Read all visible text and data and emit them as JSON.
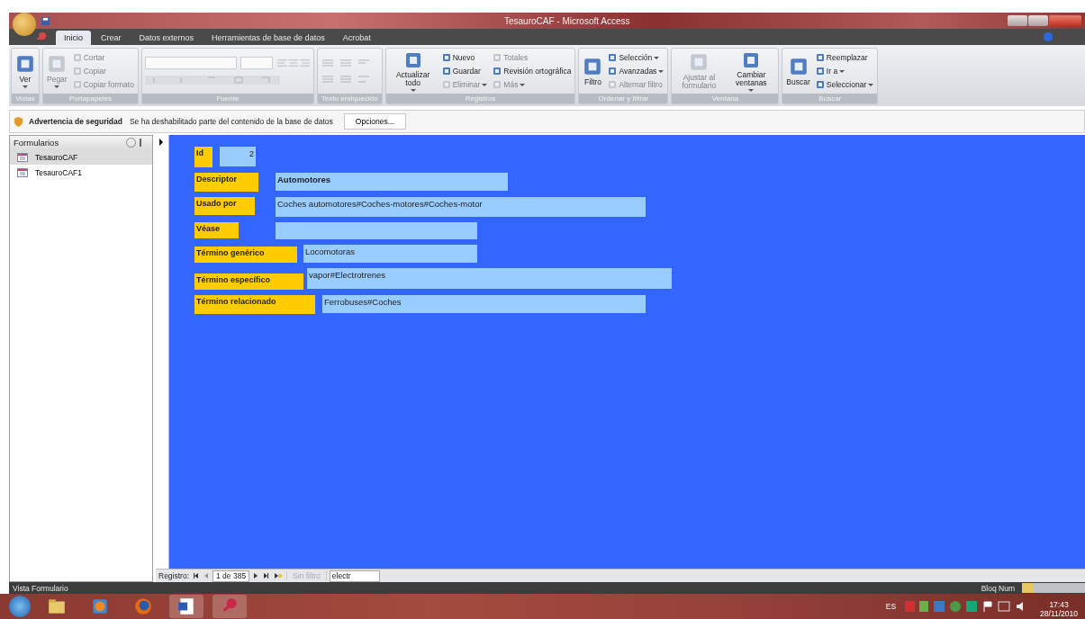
{
  "window": {
    "title": "TesauroCAF - Microsoft Access"
  },
  "tabs": [
    {
      "label": "Inicio",
      "selected": true
    },
    {
      "label": "Crear",
      "selected": false
    },
    {
      "label": "Datos externos",
      "selected": false
    },
    {
      "label": "Herramientas de base de datos",
      "selected": false
    },
    {
      "label": "Acrobat",
      "selected": false
    }
  ],
  "ribbon": [
    {
      "label": "Vistas",
      "kind": "commands",
      "items": [
        {
          "label": "Ver",
          "kind": "large",
          "disabled": false,
          "dropdown": true
        }
      ]
    },
    {
      "label": "Portapapeles",
      "kind": "commands",
      "items": [
        {
          "label": "Pegar",
          "kind": "large",
          "disabled": true,
          "dropdown": true
        },
        {
          "label": "Cortar",
          "kind": "small",
          "disabled": true,
          "dropdown": false
        },
        {
          "label": "Copiar",
          "kind": "small",
          "disabled": true,
          "dropdown": false
        },
        {
          "label": "Copiar formato",
          "kind": "small",
          "disabled": true,
          "dropdown": false
        }
      ]
    },
    {
      "label": "Fuente",
      "kind": "font"
    },
    {
      "label": "Texto enriquecido",
      "kind": "paragraph"
    },
    {
      "label": "Registros",
      "kind": "commands",
      "items": [
        {
          "label": "Actualizar todo",
          "kind": "large",
          "disabled": false,
          "dropdown": true
        },
        {
          "label": "Nuevo",
          "kind": "small",
          "disabled": false,
          "dropdown": false
        },
        {
          "label": "Guardar",
          "kind": "small",
          "disabled": false,
          "dropdown": false
        },
        {
          "label": "Eliminar",
          "kind": "small",
          "disabled": true,
          "dropdown": true
        },
        {
          "label": "Totales",
          "kind": "small",
          "disabled": true,
          "dropdown": false
        },
        {
          "label": "Revisión ortográfica",
          "kind": "small",
          "disabled": false,
          "dropdown": false
        },
        {
          "label": "Más",
          "kind": "small",
          "disabled": true,
          "dropdown": true
        }
      ]
    },
    {
      "label": "Ordenar y filtrar",
      "kind": "commands",
      "items": [
        {
          "label": "Filtro",
          "kind": "large",
          "disabled": false,
          "dropdown": false
        },
        {
          "label": "Selección",
          "kind": "small",
          "disabled": false,
          "dropdown": true
        },
        {
          "label": "Avanzadas",
          "kind": "small",
          "disabled": false,
          "dropdown": true
        },
        {
          "label": "Alternar filtro",
          "kind": "small",
          "disabled": true,
          "dropdown": false
        }
      ]
    },
    {
      "label": "Ventana",
      "kind": "commands",
      "items": [
        {
          "label": "Ajustar al formulario",
          "kind": "large",
          "disabled": true,
          "dropdown": false
        },
        {
          "label": "Cambiar ventanas",
          "kind": "large",
          "disabled": false,
          "dropdown": true
        }
      ]
    },
    {
      "label": "Buscar",
      "kind": "commands",
      "items": [
        {
          "label": "Buscar",
          "kind": "large",
          "disabled": false,
          "dropdown": false
        },
        {
          "label": "Reemplazar",
          "kind": "small",
          "disabled": false,
          "dropdown": false
        },
        {
          "label": "Ir a",
          "kind": "small",
          "disabled": false,
          "dropdown": true
        },
        {
          "label": "Seleccionar",
          "kind": "small",
          "disabled": false,
          "dropdown": true
        }
      ]
    }
  ],
  "security_bar": {
    "title": "Advertencia de seguridad",
    "message": "Se ha deshabilitado parte del contenido de la base de datos",
    "button": "Opciones..."
  },
  "navigation_pane": {
    "title": "Formularios",
    "items": [
      {
        "label": "TesauroCAF",
        "selected": true
      },
      {
        "label": "TesauroCAF1",
        "selected": false
      }
    ]
  },
  "form": {
    "fields": [
      {
        "label": "Id",
        "value": "2"
      },
      {
        "label": "Descriptor",
        "value": "Automotores"
      },
      {
        "label": "Usado por",
        "value": "Coches automotores#Coches-motores#Coches-motor"
      },
      {
        "label": "Véase"
      },
      {
        "label": "Término genérico",
        "value": "Locomotoras"
      },
      {
        "label": "Término específico",
        "value": "vapor#Electrotrenes"
      },
      {
        "label": "Término relacionado",
        "value": "Ferrobuses#Coches"
      }
    ]
  },
  "record_navigator": {
    "label": "Registro:",
    "position": "1 de 385",
    "filter": "Sin filtro",
    "search": "electr"
  },
  "status_bar": {
    "left": "Vista Formulario",
    "right": "Bloq Num"
  },
  "taskbar": {
    "language": "ES",
    "time": "17:43",
    "date": "28/11/2010"
  }
}
